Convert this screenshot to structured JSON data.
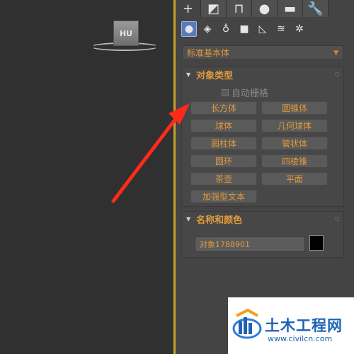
{
  "viewport": {
    "cube_label": "HU"
  },
  "panel": {
    "main_tabs": [
      {
        "name": "create-tab",
        "glyph": "+"
      },
      {
        "name": "modify-tab",
        "glyph": "◩"
      },
      {
        "name": "hierarchy-tab",
        "glyph": "⊓"
      },
      {
        "name": "motion-tab",
        "glyph": "●"
      },
      {
        "name": "display-tab",
        "glyph": "▬"
      },
      {
        "name": "utilities-tab",
        "glyph": "🔧"
      }
    ],
    "sub_tabs": [
      {
        "name": "geometry-icon",
        "glyph": "●"
      },
      {
        "name": "shapes-icon",
        "glyph": "◈"
      },
      {
        "name": "lights-icon",
        "glyph": "♁"
      },
      {
        "name": "cameras-icon",
        "glyph": "■"
      },
      {
        "name": "helpers-icon",
        "glyph": "◺"
      },
      {
        "name": "space-warps-icon",
        "glyph": "≋"
      },
      {
        "name": "systems-icon",
        "glyph": "✲"
      }
    ],
    "category": "标准基本体",
    "object_type": {
      "title": "对象类型",
      "autogrid": "自动栅格",
      "buttons": [
        "长方体",
        "圆锥体",
        "球体",
        "几何球体",
        "圆柱体",
        "管状体",
        "圆环",
        "四棱锥",
        "茶壶",
        "平面",
        "加强型文本"
      ]
    },
    "name_color": {
      "title": "名称和颜色",
      "name_value": "对象1788901",
      "color": "#000000"
    }
  },
  "watermark": {
    "title": "土木工程网",
    "url": "www.civilcn.com"
  },
  "annotation": {
    "arrow_color": "#ff2a1a"
  }
}
